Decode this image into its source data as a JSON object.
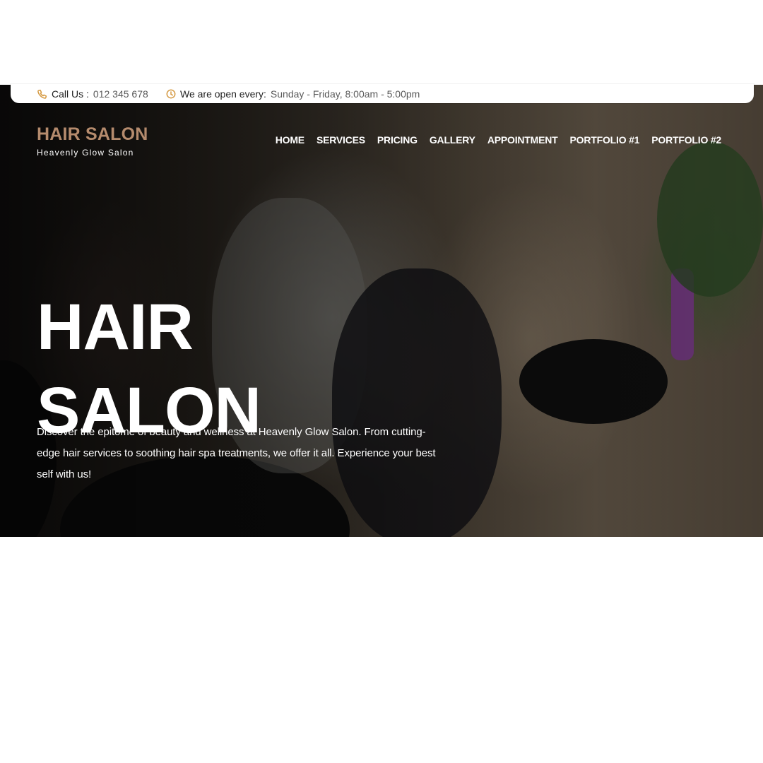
{
  "topbar": {
    "call_label": "Call Us :",
    "call_value": "012 345 678",
    "hours_label": "We are open every:",
    "hours_value": "Sunday - Friday, 8:00am - 5:00pm",
    "call_icon": "phone-icon",
    "hours_icon": "clock-icon",
    "accent": "#d59a43"
  },
  "header": {
    "logo_title": "HAIR SALON",
    "logo_subtitle": "Heavenly Glow Salon",
    "logo_color": "#b58b6d"
  },
  "nav": {
    "items": [
      {
        "label": "HOME"
      },
      {
        "label": "SERVICES"
      },
      {
        "label": "PRICING"
      },
      {
        "label": "GALLERY"
      },
      {
        "label": "APPOINTMENT"
      },
      {
        "label": "PORTFOLIO #1"
      },
      {
        "label": "PORTFOLIO #2"
      }
    ]
  },
  "hero": {
    "title_line1": "HAIR",
    "title_line2": "SALON",
    "description": "Discover the epitome of beauty and wellness at Heavenly Glow Salon. From cutting-edge hair services to soothing hair spa treatments, we offer it all. Experience your best self with us!"
  },
  "colors": {
    "background": "#ffffff",
    "hero_text": "#ffffff",
    "hero_overlay": "#000000"
  }
}
